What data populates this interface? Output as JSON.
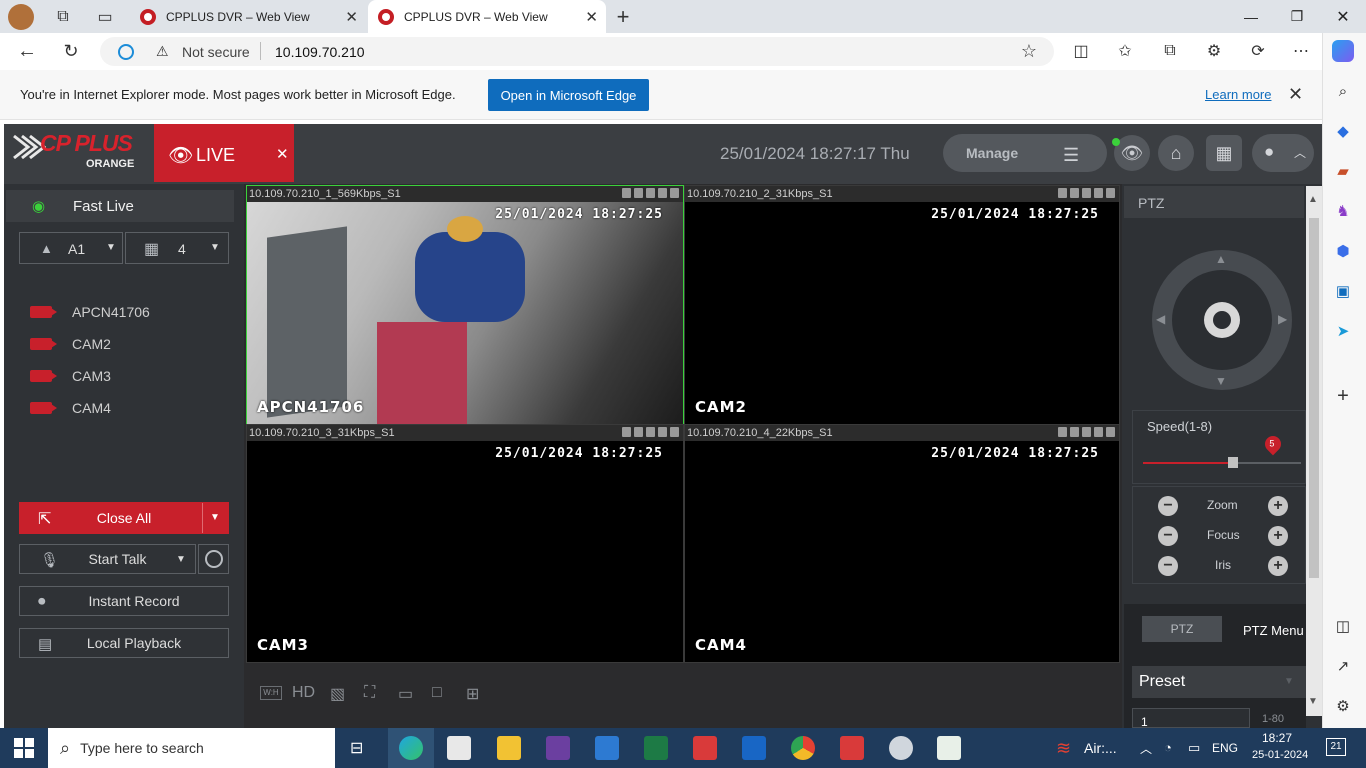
{
  "browser": {
    "tabs": [
      {
        "title": "CPPLUS DVR – Web View"
      },
      {
        "title": "CPPLUS DVR – Web View"
      }
    ],
    "security_label": "Not secure",
    "url": "10.109.70.210"
  },
  "ie_banner": {
    "message": "You're in Internet Explorer mode. Most pages work better in Microsoft Edge.",
    "open_button": "Open in Microsoft Edge",
    "learn_more": "Learn more"
  },
  "dvr": {
    "logo_text": "CP PLUS",
    "logo_sub": "ORANGE",
    "live_tab": "LIVE",
    "datetime": "25/01/2024 18:27:17 Thu",
    "manage": "Manage",
    "fast_live": "Fast Live",
    "group": "A1",
    "layout": "4",
    "cameras": [
      "APCN41706",
      "CAM2",
      "CAM3",
      "CAM4"
    ],
    "close_all": "Close All",
    "start_talk": "Start Talk",
    "instant_record": "Instant Record",
    "local_playback": "Local Playback",
    "videos": [
      {
        "stream": "10.109.70.210_1_569Kbps_S1",
        "timestamp": "25/01/2024  18:27:25",
        "name": "APCN41706"
      },
      {
        "stream": "10.109.70.210_2_31Kbps_S1",
        "timestamp": "25/01/2024  18:27:25",
        "name": "CAM2"
      },
      {
        "stream": "10.109.70.210_3_31Kbps_S1",
        "timestamp": "25/01/2024  18:27:25",
        "name": "CAM3"
      },
      {
        "stream": "10.109.70.210_4_22Kbps_S1",
        "timestamp": "25/01/2024  18:27:25",
        "name": "CAM4"
      }
    ],
    "bottom_toolbar": {
      "wh": "W:H",
      "hd": "HD"
    },
    "ptz": {
      "title": "PTZ",
      "speed_label": "Speed(1-8)",
      "speed_value": "5",
      "speed_fraction": 0.57,
      "zoom": "Zoom",
      "focus": "Focus",
      "iris": "Iris",
      "tab_ptz": "PTZ",
      "tab_menu": "PTZ Menu",
      "preset": "Preset",
      "preset_input": "1",
      "preset_range": "1-80"
    }
  },
  "taskbar": {
    "search_placeholder": "Type here to search",
    "weather": "Air:...",
    "lang": "ENG",
    "time": "18:27",
    "date": "25-01-2024",
    "notifications": "21"
  },
  "colors": {
    "brand_red": "#c8202b",
    "edge_blue": "#0f6cbd",
    "active_border": "#3bd13b"
  }
}
